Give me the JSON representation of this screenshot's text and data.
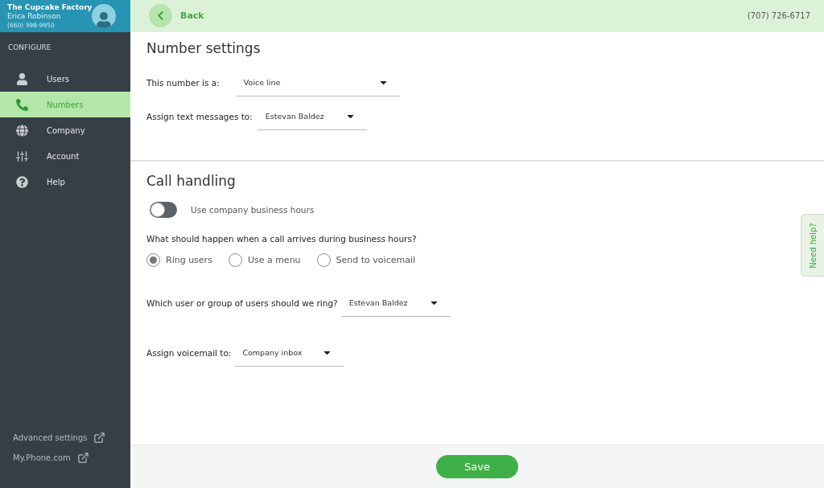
{
  "account": {
    "company": "The Cupcake Factory",
    "user": "Erica Robinson",
    "phone": "(660) 398-9950"
  },
  "sidebar": {
    "section": "CONFIGURE",
    "items": [
      {
        "label": "Users",
        "selected": false
      },
      {
        "label": "Numbers",
        "selected": true
      },
      {
        "label": "Company",
        "selected": false
      },
      {
        "label": "Account",
        "selected": false
      },
      {
        "label": "Help",
        "selected": false
      }
    ],
    "links": [
      "Advanced settings",
      "My.Phone.com"
    ]
  },
  "topbar": {
    "back": "Back",
    "number": "(707) 726-6717"
  },
  "number_settings": {
    "title": "Number settings",
    "fields": [
      {
        "label": "This number is a:",
        "value": "Voice line"
      },
      {
        "label": "Assign text messages to:",
        "value": "Estevan Baldez"
      }
    ]
  },
  "call_handling": {
    "title": "Call handling",
    "toggle": {
      "label": "Use company business hours",
      "on": false
    },
    "question": "What should happen when a call arrives during business hours?",
    "options": [
      {
        "label": "Ring users",
        "selected": true
      },
      {
        "label": "Use a menu",
        "selected": false
      },
      {
        "label": "Send to voicemail",
        "selected": false
      }
    ],
    "fields": [
      {
        "label": "Which user or group of users should we ring?",
        "value": "Estevan Baldez"
      },
      {
        "label": "Assign voicemail to:",
        "value": "Company inbox"
      }
    ]
  },
  "help_tab": "Need help?",
  "save": "Save"
}
